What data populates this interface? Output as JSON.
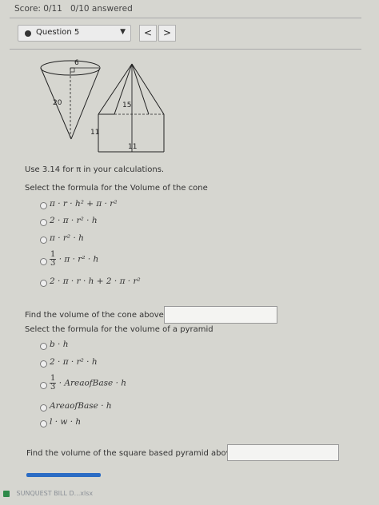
{
  "header": {
    "score": "Score: 0/11",
    "answered": "0/10 answered",
    "question_label": "Question 5",
    "caret": "▼",
    "prev": "<",
    "next": ">"
  },
  "figure": {
    "cone_radius": "6",
    "cone_height": "20",
    "pyramid_height": "15",
    "pyramid_side_left": "11",
    "pyramid_side_bottom": "11"
  },
  "main": {
    "instruction": "Use 3.14 for π in your calculations.",
    "q1_prompt": "Select the formula for the Volume of the cone",
    "q1_options": [
      "π · r · h² + π · r²",
      "2 · π · r² · h",
      "π · r² · h",
      "· π · r² · h",
      "2 · π · r · h + 2 · π · r²"
    ],
    "frac_num": "1",
    "frac_den": "3",
    "q2_prompt": "Find the volume of the cone above.",
    "q3_prompt": "Select the formula for the volume of a pyramid",
    "q3_options": [
      "b · h",
      "2 · π · r² · h",
      "· AreaofBase · h",
      "AreaofBase · h",
      "l · w · h"
    ],
    "q4_prompt": "Find the volume of the square based pyramid above."
  },
  "footer": {
    "text": "SUNQUEST BILL D...xlsx"
  }
}
